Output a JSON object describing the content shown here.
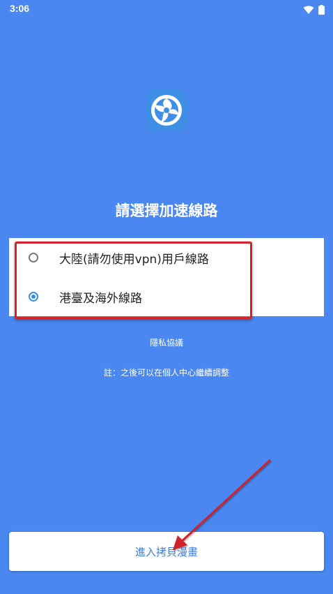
{
  "status_bar": {
    "time": "3:06",
    "icons": [
      "wifi-icon",
      "battery-icon"
    ]
  },
  "header": {
    "logo_icon": "app-logo-icon",
    "title": "請選擇加速線路"
  },
  "options": [
    {
      "label": "大陸(請勿使用vpn)用戶線路",
      "selected": false
    },
    {
      "label": "港臺及海外線路",
      "selected": true
    }
  ],
  "links": {
    "privacy": "隱私協議",
    "note": "註：之後可以在個人中心繼續調整"
  },
  "enter_button": {
    "label": "進入拷貝漫畫"
  },
  "colors": {
    "background": "#4a87f0",
    "accent": "#3b8ee8",
    "annotation_red": "#d0232a"
  }
}
